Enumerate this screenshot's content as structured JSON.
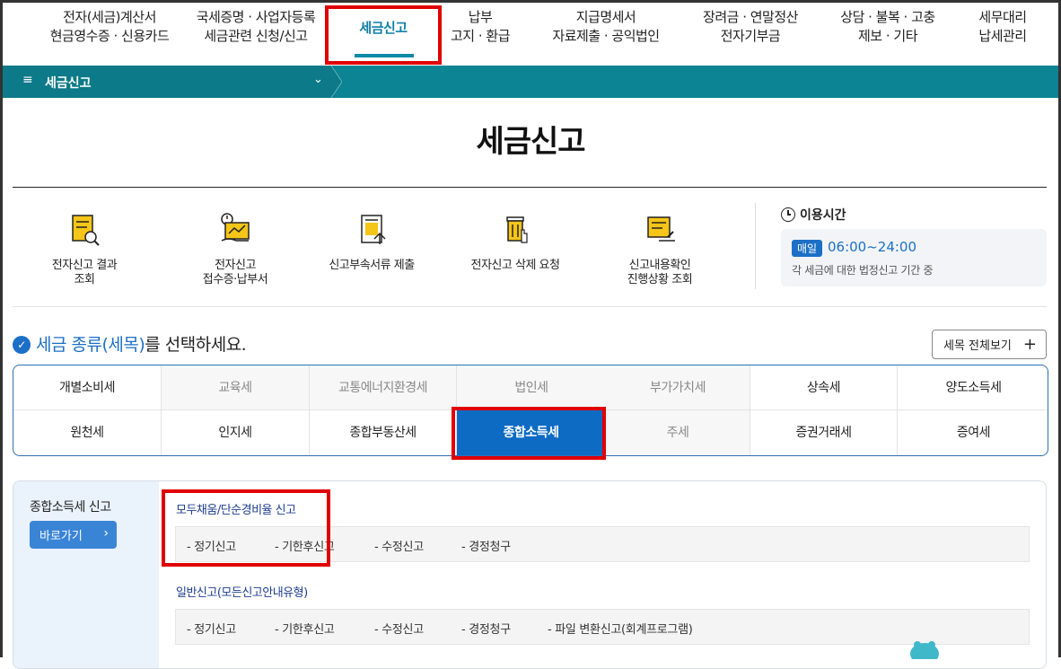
{
  "nav": {
    "items": [
      {
        "line1": "전자(세금)계산서",
        "line2": "현금영수증 · 신용카드"
      },
      {
        "line1": "국세증명 · 사업자등록",
        "line2": "세금관련 신청/신고"
      },
      {
        "line1": "세금신고",
        "line2": ""
      },
      {
        "line1": "납부",
        "line2": "고지 · 환급"
      },
      {
        "line1": "지급명세서",
        "line2": "자료제출 · 공익법인"
      },
      {
        "line1": "장려금 · 연말정산",
        "line2": "전자기부금"
      },
      {
        "line1": "상담 · 불복 · 고충",
        "line2": "제보 · 기타"
      },
      {
        "line1": "세무대리",
        "line2": "납세관리"
      }
    ],
    "active": "세금신고"
  },
  "breadcrumb": {
    "menu_icon": "menu-icon",
    "label": "세금신고"
  },
  "page_title": "세금신고",
  "quick_menu": [
    {
      "icon": "document-search-icon",
      "line1": "전자신고 결과",
      "line2": "조회"
    },
    {
      "icon": "receipt-chart-icon",
      "line1": "전자신고",
      "line2": "접수증·납부서"
    },
    {
      "icon": "document-upload-icon",
      "line1": "신고부속서류 제출",
      "line2": ""
    },
    {
      "icon": "trash-delete-icon",
      "line1": "전자신고 삭제 요청",
      "line2": ""
    },
    {
      "icon": "document-check-icon",
      "line1": "신고내용확인",
      "line2": "진행상황 조회"
    }
  ],
  "hours": {
    "title": "이용시간",
    "badge": "매일",
    "time": "06:00~24:00",
    "note": "각 세금에 대한 법정신고 기간 중"
  },
  "select": {
    "title_highlight": "세금 종류(세목)",
    "title_rest": "를 선택하세요.",
    "all_button": "세목 전체보기",
    "all_button_icon": "+"
  },
  "tax_grid": {
    "row1": [
      "개별소비세",
      "교육세",
      "교통에너지환경세",
      "법인세",
      "부가가치세",
      "상속세",
      "양도소득세"
    ],
    "row2": [
      "원천세",
      "인지세",
      "종합부동산세",
      "종합소득세",
      "주세",
      "증권거래세",
      "증여세"
    ],
    "selected": "종합소득세"
  },
  "section": {
    "title": "종합소득세 신고",
    "goto_button": "바로가기",
    "goto_arrow": "›",
    "groups": [
      {
        "title": "모두채움/단순경비율 신고",
        "links": [
          "- 정기신고",
          "- 기한후신고",
          "- 수정신고",
          "- 경정청구"
        ]
      },
      {
        "title": "일반신고(모든신고안내유형)",
        "links": [
          "- 정기신고",
          "- 기한후신고",
          "- 수정신고",
          "- 경정청구",
          "- 파일 변환신고(회계프로그램)"
        ]
      }
    ]
  },
  "colors": {
    "accent": "#0d8493",
    "primary": "#0d6bc4",
    "highlight_box": "#e00000"
  }
}
